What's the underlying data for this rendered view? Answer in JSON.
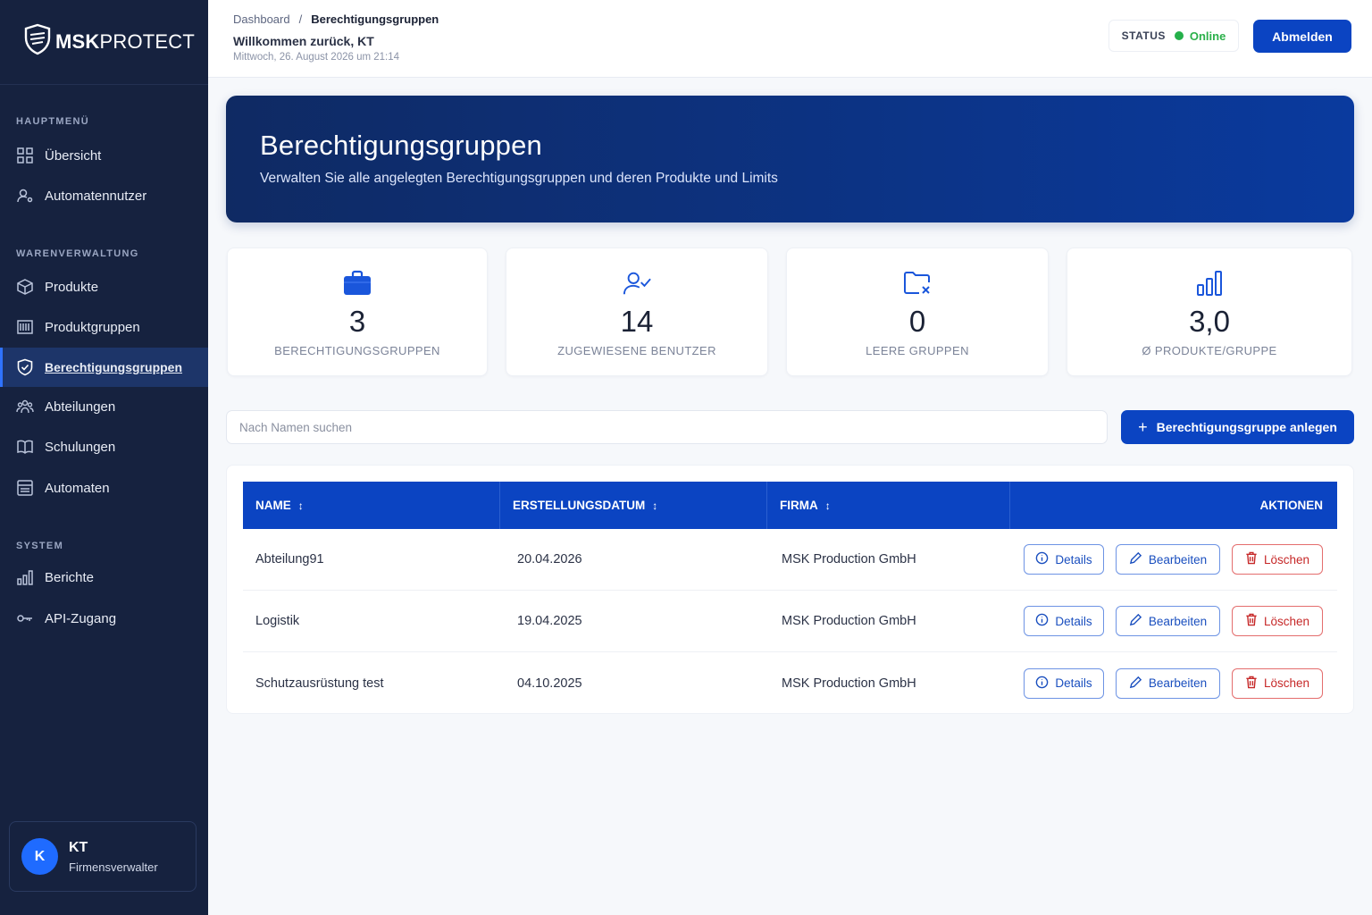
{
  "brand": {
    "strong": "MSK",
    "light": "PROTECT"
  },
  "sidebar": {
    "sections": [
      {
        "title": "HAUPTMENÜ"
      },
      {
        "title": "WARENVERWALTUNG"
      },
      {
        "title": "SYSTEM"
      }
    ],
    "items": [
      {
        "label": "Übersicht",
        "icon": "grid-icon"
      },
      {
        "label": "Automatennutzer",
        "icon": "user-settings-icon"
      },
      {
        "label": "Produkte",
        "icon": "box-icon"
      },
      {
        "label": "Produktgruppen",
        "icon": "barcode-icon"
      },
      {
        "label": "Berechtigungsgruppen",
        "icon": "shield-check-icon",
        "active": true
      },
      {
        "label": "Abteilungen",
        "icon": "team-icon"
      },
      {
        "label": "Schulungen",
        "icon": "book-icon"
      },
      {
        "label": "Automaten",
        "icon": "vending-icon"
      },
      {
        "label": "Berichte",
        "icon": "bar-chart-icon"
      },
      {
        "label": "API-Zugang",
        "icon": "key-icon"
      }
    ],
    "user": {
      "initial": "K",
      "name": "KT",
      "role": "Firmensverwalter"
    }
  },
  "header": {
    "breadcrumb": {
      "root": "Dashboard",
      "separator": "/",
      "current": "Berechtigungsgruppen"
    },
    "welcome": "Willkommen zurück, KT",
    "datetime": "Mittwoch, 26. August 2026 um 21:14",
    "status_label": "STATUS",
    "status_value": "Online",
    "logout": "Abmelden"
  },
  "hero": {
    "title": "Berechtigungsgruppen",
    "subtitle": "Verwalten Sie alle angelegten Berechtigungsgruppen und deren Produkte und Limits"
  },
  "stats": [
    {
      "value": "3",
      "label": "BERECHTIGUNGSGRUPPEN",
      "icon": "briefcase-icon"
    },
    {
      "value": "14",
      "label": "ZUGEWIESENE BENUTZER",
      "icon": "user-check-icon"
    },
    {
      "value": "0",
      "label": "LEERE GRUPPEN",
      "icon": "folder-x-icon"
    },
    {
      "value": "3,0",
      "label": "Ø PRODUKTE/GRUPPE",
      "icon": "bar-chart-icon"
    }
  ],
  "search": {
    "placeholder": "Nach Namen suchen"
  },
  "add_button": "Berechtigungsgruppe anlegen",
  "table": {
    "columns": [
      "NAME",
      "ERSTELLUNGSDATUM",
      "FIRMA",
      "AKTIONEN"
    ],
    "rows": [
      {
        "name": "Abteilung91",
        "date": "20.04.2026",
        "company": "MSK Production GmbH"
      },
      {
        "name": "Logistik",
        "date": "19.04.2025",
        "company": "MSK Production GmbH"
      },
      {
        "name": "Schutzausrüstung test",
        "date": "04.10.2025",
        "company": "MSK Production GmbH"
      }
    ],
    "actions": {
      "details": "Details",
      "edit": "Bearbeiten",
      "delete": "Löschen"
    }
  },
  "colors": {
    "sidebar_bg": "#16223f",
    "primary": "#0b44c2",
    "online": "#2bb04a",
    "danger": "#c62828"
  }
}
